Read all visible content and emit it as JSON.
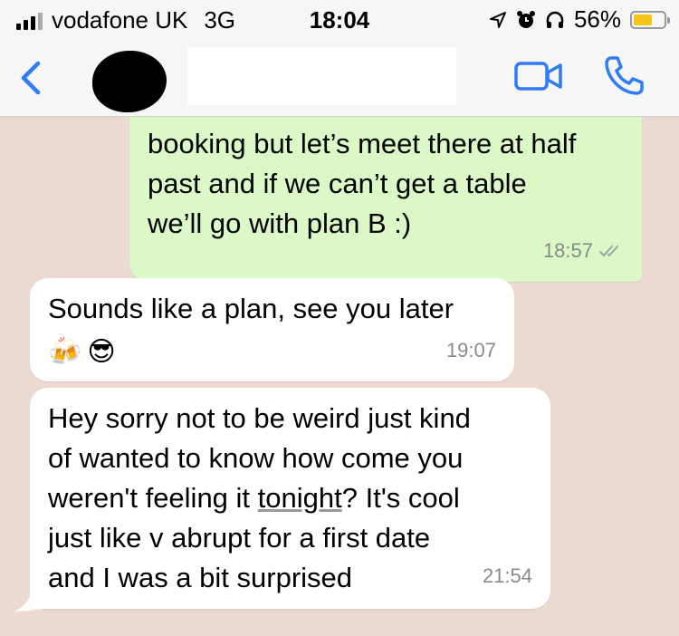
{
  "status_bar": {
    "carrier": "vodafone UK",
    "network": "3G",
    "time": "18:04",
    "battery_percent": "56%",
    "battery_level": 0.56,
    "icons": [
      "signal-bars-icon",
      "location-arrow-icon",
      "alarm-icon",
      "headphones-icon",
      "battery-icon"
    ]
  },
  "header": {
    "back_icon": "chevron-left-icon",
    "video_icon": "video-camera-icon",
    "call_icon": "phone-icon",
    "accent": "#2f7cf6"
  },
  "messages": [
    {
      "direction": "outgoing",
      "lines": [
        "booking but let’s meet there at half",
        "past and if we can’t get a table",
        "we’ll go with plan B :)"
      ],
      "time": "18:57",
      "status": "delivered-double-tick"
    },
    {
      "direction": "incoming",
      "text": "Sounds like a plan, see you later",
      "emojis": [
        "🍻",
        "😎"
      ],
      "time": "19:07"
    },
    {
      "direction": "incoming",
      "line1": "Hey sorry not to be weird just kind",
      "line2": "of wanted to know how come you",
      "line3_a": "weren't feeling it ",
      "line3_b": "tonight",
      "line3_c": "? It's cool",
      "line4": "just like v abrupt for a first date",
      "line5": "and I was a bit surprised",
      "time": "21:54"
    }
  ],
  "colors": {
    "chat_background": "#ecd9d1",
    "outgoing_bubble": "#dcf8c6",
    "incoming_bubble": "#ffffff",
    "timestamp": "#8a8a8a"
  }
}
